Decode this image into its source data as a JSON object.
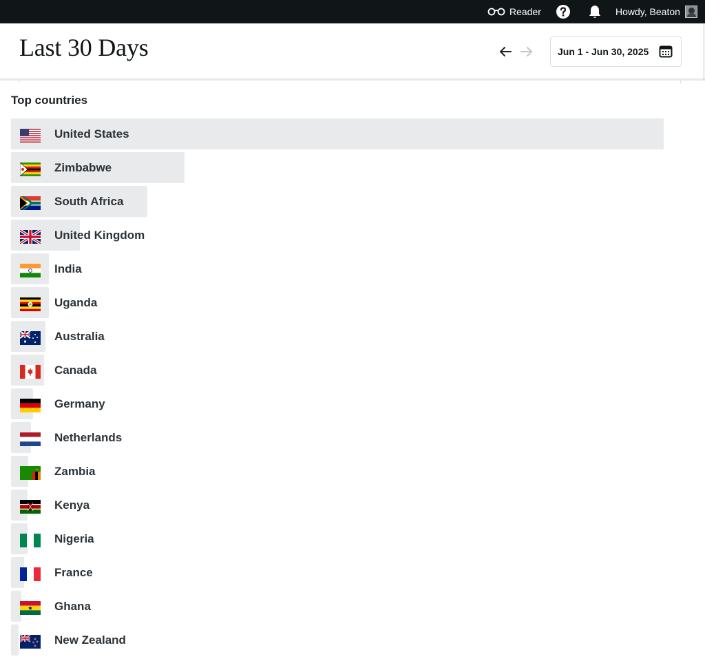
{
  "adminbar": {
    "reader_label": "Reader",
    "help_icon": "question-circle-icon",
    "notifications_icon": "bell-icon",
    "user_greeting": "Howdy, Beaton"
  },
  "header": {
    "title": "Last 30 Days",
    "prev_icon": "arrow-left-icon",
    "next_icon": "arrow-right-icon",
    "date_range": "Jun 1 - Jun 30, 2025",
    "calendar_icon": "calendar-icon"
  },
  "countries": {
    "section_title": "Top countries",
    "items": [
      {
        "name": "United States",
        "flag": "flag-us",
        "relative_share": 1.0
      },
      {
        "name": "Zimbabwe",
        "flag": "flag-zw",
        "relative_share": 0.266
      },
      {
        "name": "South Africa",
        "flag": "flag-za",
        "relative_share": 0.209
      },
      {
        "name": "United Kingdom",
        "flag": "flag-gb",
        "relative_share": 0.106
      },
      {
        "name": "India",
        "flag": "flag-in",
        "relative_share": 0.058
      },
      {
        "name": "Uganda",
        "flag": "flag-ug",
        "relative_share": 0.058
      },
      {
        "name": "Australia",
        "flag": "flag-au",
        "relative_share": 0.053
      },
      {
        "name": "Canada",
        "flag": "flag-ca",
        "relative_share": 0.051
      },
      {
        "name": "Germany",
        "flag": "flag-de",
        "relative_share": 0.034
      },
      {
        "name": "Netherlands",
        "flag": "flag-nl",
        "relative_share": 0.031
      },
      {
        "name": "Zambia",
        "flag": "flag-zm",
        "relative_share": 0.026
      },
      {
        "name": "Kenya",
        "flag": "flag-ke",
        "relative_share": 0.025
      },
      {
        "name": "Nigeria",
        "flag": "flag-ng",
        "relative_share": 0.025
      },
      {
        "name": "France",
        "flag": "flag-fr",
        "relative_share": 0.02
      },
      {
        "name": "Ghana",
        "flag": "flag-gh",
        "relative_share": 0.016
      },
      {
        "name": "New Zealand",
        "flag": "flag-nz",
        "relative_share": 0.012
      }
    ]
  },
  "colors": {
    "adminbar_bg": "#101517",
    "bar_fill": "#e9eaec",
    "text": "#2c3338"
  }
}
